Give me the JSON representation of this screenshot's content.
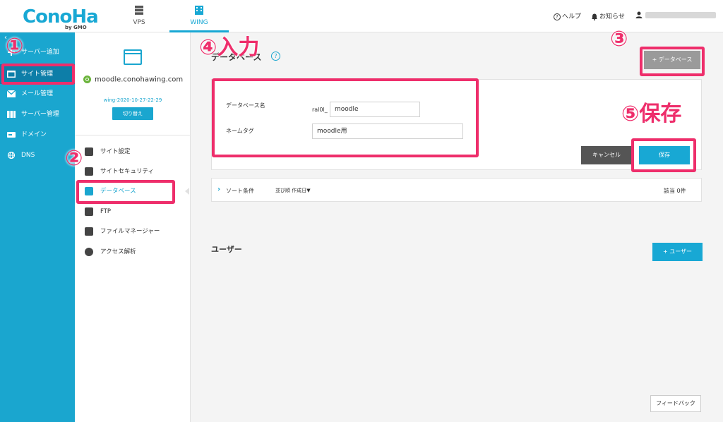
{
  "header": {
    "logo_text": "ConoHa",
    "logo_sub": "by GMO",
    "tabs": [
      {
        "label": "VPS",
        "icon": "server-icon"
      },
      {
        "label": "WING",
        "icon": "building-icon",
        "active": true
      }
    ],
    "help_label": "ヘルプ",
    "notice_label": "お知らせ"
  },
  "sidebar": {
    "collapse_glyph": "‹",
    "items": [
      {
        "label": "サーバー追加",
        "icon": "plus-icon"
      },
      {
        "label": "サイト管理",
        "icon": "window-icon",
        "active": true
      },
      {
        "label": "メール管理",
        "icon": "mail-icon"
      },
      {
        "label": "サーバー管理",
        "icon": "server-icon"
      },
      {
        "label": "ドメイン",
        "icon": "domain-icon"
      },
      {
        "label": "DNS",
        "icon": "globe-icon"
      }
    ]
  },
  "site": {
    "domain": "moodle.conohawing.com",
    "wing_id": "wing-2020-10-27-22-29",
    "switch_label": "切り替え"
  },
  "site_nav": [
    {
      "label": "サイト設定",
      "icon": "settings-icon"
    },
    {
      "label": "サイトセキュリティ",
      "icon": "shield-icon"
    },
    {
      "label": "データベース",
      "icon": "database-icon",
      "active": true
    },
    {
      "label": "FTP",
      "icon": "transfer-icon"
    },
    {
      "label": "ファイルマネージャー",
      "icon": "folder-icon"
    },
    {
      "label": "アクセス解析",
      "icon": "pie-chart-icon"
    }
  ],
  "main": {
    "section_title": "データベース",
    "help_glyph": "?",
    "add_db_label": "+ データベース",
    "form": {
      "db_name_label": "データベース名",
      "db_prefix": "ral0l_",
      "db_name_value": "moodle",
      "tag_label": "ネームタグ",
      "tag_value": "moodle用",
      "cancel_label": "キャンセル",
      "save_label": "保存"
    },
    "sort": {
      "chevron": "›",
      "label": "ソート条件",
      "order": "並び順  作成日▼",
      "count": "該当 0件"
    },
    "users_title": "ユーザー",
    "add_user_label": "+ ユーザー",
    "feedback_label": "フィードバック"
  },
  "annotations": {
    "step1": "①",
    "step2": "②",
    "step3": "③",
    "step4": "④入力",
    "step5": "⑤保存"
  },
  "colors": {
    "accent": "#18a8d4",
    "sidebar": "#1aa6cf",
    "annotation": "#ee2e6b"
  }
}
